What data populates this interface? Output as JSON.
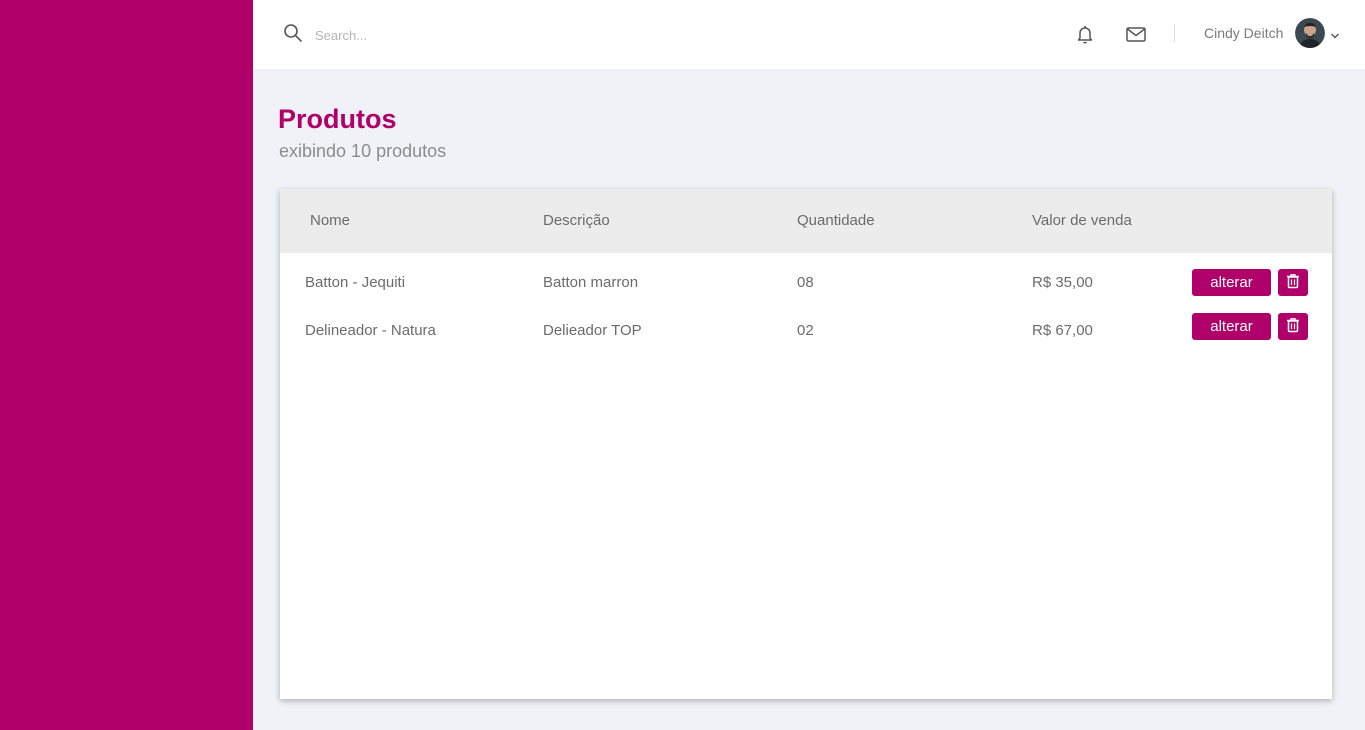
{
  "search": {
    "placeholder": "Search..."
  },
  "user": {
    "name": "Cindy Deitch"
  },
  "page": {
    "title": "Produtos",
    "subtitle": "exibindo 10 produtos"
  },
  "table": {
    "headers": [
      "Nome",
      "Descrição",
      "Quantidade",
      "Valor de venda"
    ],
    "rows": [
      {
        "nome": "Batton - Jequiti",
        "descricao": "Batton marron",
        "quantidade": "08",
        "valor": "R$ 35,00",
        "edit_label": "alterar"
      },
      {
        "nome": "Delineador - Natura",
        "descricao": "Delieador TOP",
        "quantidade": "02",
        "valor": "R$ 67,00",
        "edit_label": "alterar"
      }
    ]
  },
  "colors": {
    "brand": "#b0006a",
    "background": "#f1f2f7",
    "table_header": "#ececec"
  },
  "icons": [
    "search-icon",
    "bell-icon",
    "mail-icon",
    "chevron-down-icon",
    "trash-icon"
  ]
}
